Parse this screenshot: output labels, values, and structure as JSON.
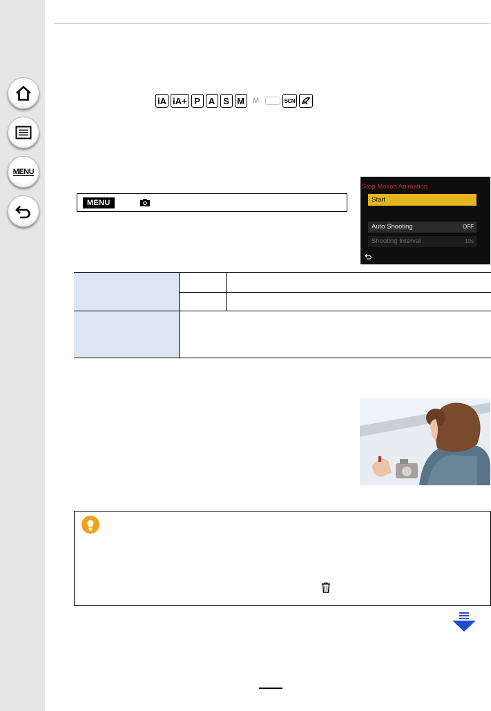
{
  "sidebar": {
    "menu_label": "MENU"
  },
  "mode_icons": {
    "items": [
      "iA",
      "iA+",
      "P",
      "A",
      "S",
      "M",
      "M",
      "SCN"
    ]
  },
  "menu_path": {
    "badge": "MENU"
  },
  "camera_screen": {
    "title": "Stop Motion Animation",
    "items": [
      {
        "label": "Start"
      },
      {
        "label": "Auto Shooting",
        "value": "OFF"
      },
      {
        "label": "Shooting Interval",
        "value": "10s"
      }
    ]
  },
  "page": {
    "number": ""
  },
  "colors": {
    "sidebar_bg": "#e6e6e6",
    "table_shade": "#dde4f4",
    "lcd_highlight": "#e4b521",
    "lcd_title": "#c32a23",
    "tip_icon": "#f0a21a",
    "arrow_blue": "#1e4fc8"
  },
  "icons": {
    "nav": [
      "home-icon",
      "contents-list-icon",
      "menu-icon",
      "back-icon"
    ],
    "other": [
      "camera-icon",
      "lightbulb-tip-icon",
      "trash-icon",
      "down-arrow-icon"
    ]
  }
}
